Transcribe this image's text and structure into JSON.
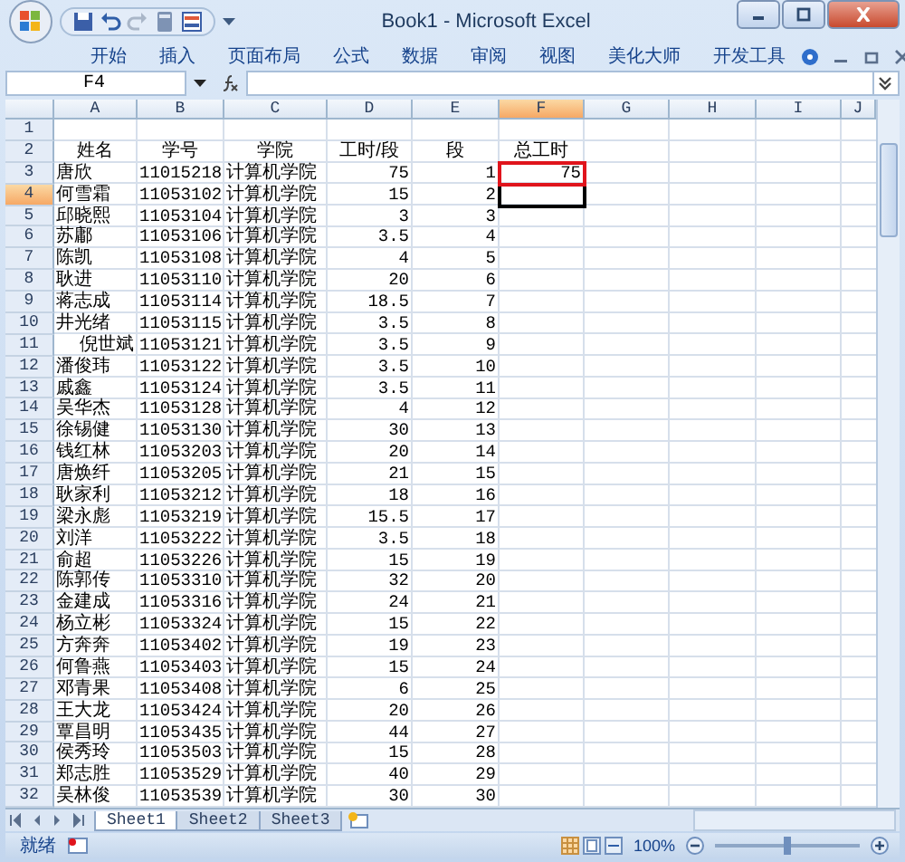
{
  "window": {
    "title": "Book1 - Microsoft Excel"
  },
  "ribbon_tabs": [
    "开始",
    "插入",
    "页面布局",
    "公式",
    "数据",
    "审阅",
    "视图",
    "美化大师",
    "开发工具"
  ],
  "name_box": "F4",
  "columns": [
    {
      "label": "A",
      "selected": false
    },
    {
      "label": "B",
      "selected": false
    },
    {
      "label": "C",
      "selected": false
    },
    {
      "label": "D",
      "selected": false
    },
    {
      "label": "E",
      "selected": false
    },
    {
      "label": "F",
      "selected": true
    },
    {
      "label": "G",
      "selected": false
    },
    {
      "label": "H",
      "selected": false
    },
    {
      "label": "I",
      "selected": false
    },
    {
      "label": "J",
      "selected": false
    }
  ],
  "rows": [
    {
      "header": "1",
      "kind": "blank",
      "selected": false
    },
    {
      "header": "2",
      "kind": "heading",
      "selected": false,
      "name": "姓名",
      "id": "学号",
      "college": "学院",
      "hours": "工时/段",
      "segment": "段",
      "total": "总工时"
    },
    {
      "header": "3",
      "kind": "data",
      "selected": false,
      "marked": true,
      "name": "唐欣",
      "id": "11015218",
      "college": "计算机学院",
      "hours": "75",
      "segment": "1",
      "total": "75"
    },
    {
      "header": "4",
      "kind": "data",
      "selected": true,
      "name": "何雪霜",
      "id": "11053102",
      "college": "计算机学院",
      "hours": "15",
      "segment": "2"
    },
    {
      "header": "5",
      "kind": "data",
      "selected": false,
      "name": "邱晓熙",
      "id": "11053104",
      "college": "计算机学院",
      "hours": "3",
      "segment": "3"
    },
    {
      "header": "6",
      "kind": "data",
      "selected": false,
      "name": "苏鄘",
      "id": "11053106",
      "college": "计算机学院",
      "hours": "3.5",
      "segment": "4"
    },
    {
      "header": "7",
      "kind": "data",
      "selected": false,
      "name": "陈凯",
      "id": "11053108",
      "college": "计算机学院",
      "hours": "4",
      "segment": "5"
    },
    {
      "header": "8",
      "kind": "data",
      "selected": false,
      "name": "耿进",
      "id": "11053110",
      "college": "计算机学院",
      "hours": "20",
      "segment": "6"
    },
    {
      "header": "9",
      "kind": "data",
      "selected": false,
      "name": "蒋志成",
      "id": "11053114",
      "college": "计算机学院",
      "hours": "18.5",
      "segment": "7"
    },
    {
      "header": "10",
      "kind": "data",
      "selected": false,
      "name": "井光绪",
      "id": "11053115",
      "college": "计算机学院",
      "hours": "3.5",
      "segment": "8"
    },
    {
      "header": "11",
      "kind": "data",
      "selected": false,
      "name_right_aligned": true,
      "name": "倪世斌",
      "id": "11053121",
      "college": "计算机学院",
      "hours": "3.5",
      "segment": "9"
    },
    {
      "header": "12",
      "kind": "data",
      "selected": false,
      "name": "潘俊玮",
      "id": "11053122",
      "college": "计算机学院",
      "hours": "3.5",
      "segment": "10"
    },
    {
      "header": "13",
      "kind": "data",
      "selected": false,
      "name": "戚鑫",
      "id": "11053124",
      "college": "计算机学院",
      "hours": "3.5",
      "segment": "11"
    },
    {
      "header": "14",
      "kind": "data",
      "selected": false,
      "name": "吴华杰",
      "id": "11053128",
      "college": "计算机学院",
      "hours": "4",
      "segment": "12"
    },
    {
      "header": "15",
      "kind": "data",
      "selected": false,
      "name": "徐锡健",
      "id": "11053130",
      "college": "计算机学院",
      "hours": "30",
      "segment": "13"
    },
    {
      "header": "16",
      "kind": "data",
      "selected": false,
      "name": "钱红林",
      "id": "11053203",
      "college": "计算机学院",
      "hours": "20",
      "segment": "14"
    },
    {
      "header": "17",
      "kind": "data",
      "selected": false,
      "name": "唐焕纤",
      "id": "11053205",
      "college": "计算机学院",
      "hours": "21",
      "segment": "15"
    },
    {
      "header": "18",
      "kind": "data",
      "selected": false,
      "name": "耿家利",
      "id": "11053212",
      "college": "计算机学院",
      "hours": "18",
      "segment": "16"
    },
    {
      "header": "19",
      "kind": "data",
      "selected": false,
      "name": "梁永彪",
      "id": "11053219",
      "college": "计算机学院",
      "hours": "15.5",
      "segment": "17"
    },
    {
      "header": "20",
      "kind": "data",
      "selected": false,
      "name": "刘洋",
      "id": "11053222",
      "college": "计算机学院",
      "hours": "3.5",
      "segment": "18"
    },
    {
      "header": "21",
      "kind": "data",
      "selected": false,
      "name": "俞超",
      "id": "11053226",
      "college": "计算机学院",
      "hours": "15",
      "segment": "19"
    },
    {
      "header": "22",
      "kind": "data",
      "selected": false,
      "name": "陈郭传",
      "id": "11053310",
      "college": "计算机学院",
      "hours": "32",
      "segment": "20"
    },
    {
      "header": "23",
      "kind": "data",
      "selected": false,
      "name": "金建成",
      "id": "11053316",
      "college": "计算机学院",
      "hours": "24",
      "segment": "21"
    },
    {
      "header": "24",
      "kind": "data",
      "selected": false,
      "name": "杨立彬",
      "id": "11053324",
      "college": "计算机学院",
      "hours": "15",
      "segment": "22"
    },
    {
      "header": "25",
      "kind": "data",
      "selected": false,
      "name": "方奔奔",
      "id": "11053402",
      "college": "计算机学院",
      "hours": "19",
      "segment": "23"
    },
    {
      "header": "26",
      "kind": "data",
      "selected": false,
      "name": "何鲁燕",
      "id": "11053403",
      "college": "计算机学院",
      "hours": "15",
      "segment": "24"
    },
    {
      "header": "27",
      "kind": "data",
      "selected": false,
      "name": "邓青果",
      "id": "11053408",
      "college": "计算机学院",
      "hours": "6",
      "segment": "25"
    },
    {
      "header": "28",
      "kind": "data",
      "selected": false,
      "name": "王大龙",
      "id": "11053424",
      "college": "计算机学院",
      "hours": "20",
      "segment": "26"
    },
    {
      "header": "29",
      "kind": "data",
      "selected": false,
      "name": "覃昌明",
      "id": "11053435",
      "college": "计算机学院",
      "hours": "44",
      "segment": "27"
    },
    {
      "header": "30",
      "kind": "data",
      "selected": false,
      "name": "侯秀玲",
      "id": "11053503",
      "college": "计算机学院",
      "hours": "15",
      "segment": "28"
    },
    {
      "header": "31",
      "kind": "data",
      "selected": false,
      "name": "郑志胜",
      "id": "11053529",
      "college": "计算机学院",
      "hours": "40",
      "segment": "29"
    },
    {
      "header": "32",
      "kind": "data",
      "selected": false,
      "name": "吴林俊",
      "id": "11053539",
      "college": "计算机学院",
      "hours": "30",
      "segment": "30"
    }
  ],
  "sheet_tabs": [
    {
      "label": "Sheet1",
      "selected": true
    },
    {
      "label": "Sheet2",
      "selected": false
    },
    {
      "label": "Sheet3",
      "selected": false
    }
  ],
  "status_bar": {
    "status": "就绪",
    "zoom": {
      "reading": "100%",
      "level": 0.5
    }
  }
}
